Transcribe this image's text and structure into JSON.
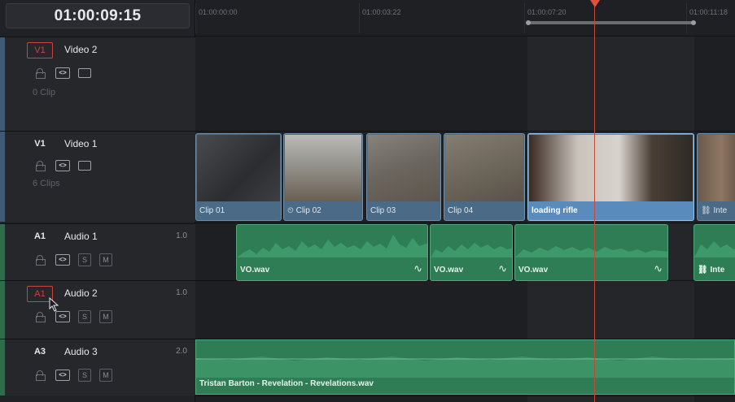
{
  "timecode": "01:00:09:15",
  "ruler": {
    "marks": [
      "01:00:00:00",
      "01:00:03:22",
      "01:00:07:20",
      "01:00:11:18"
    ]
  },
  "tracks": [
    {
      "id": "v2",
      "badge": "V1",
      "name": "Video 2",
      "count": "0 Clip",
      "accent": "#4a6a8c"
    },
    {
      "id": "v1",
      "badge": "V1",
      "name": "Video 1",
      "count": "6 Clips",
      "accent": "#4a6a8c"
    },
    {
      "id": "a1",
      "badge": "A1",
      "name": "Audio 1",
      "volume": "1.0",
      "accent": "#2f7a52"
    },
    {
      "id": "a2",
      "badge": "A1",
      "name": "Audio 2",
      "volume": "1.0",
      "accent": "#2f7a52"
    },
    {
      "id": "a3",
      "badge": "A3",
      "name": "Audio 3",
      "volume": "2.0",
      "accent": "#2f7a52"
    }
  ],
  "controls": {
    "solo": "S",
    "mute": "M",
    "link": "<>"
  },
  "video_clips": [
    "Clip 01",
    "Clip 02",
    "Clip 03",
    "Clip 04",
    "loading rifle",
    "Inte"
  ],
  "audio_clips": [
    "VO.wav",
    "VO.wav",
    "VO.wav",
    "Inte"
  ],
  "music_clip": "Tristan Barton - Revelation - Revelations.wav",
  "colors": {
    "video": "#4b6a86",
    "video_selected": "#5a8bbd",
    "audio": "#2e7d55",
    "playhead": "#e0503f"
  }
}
